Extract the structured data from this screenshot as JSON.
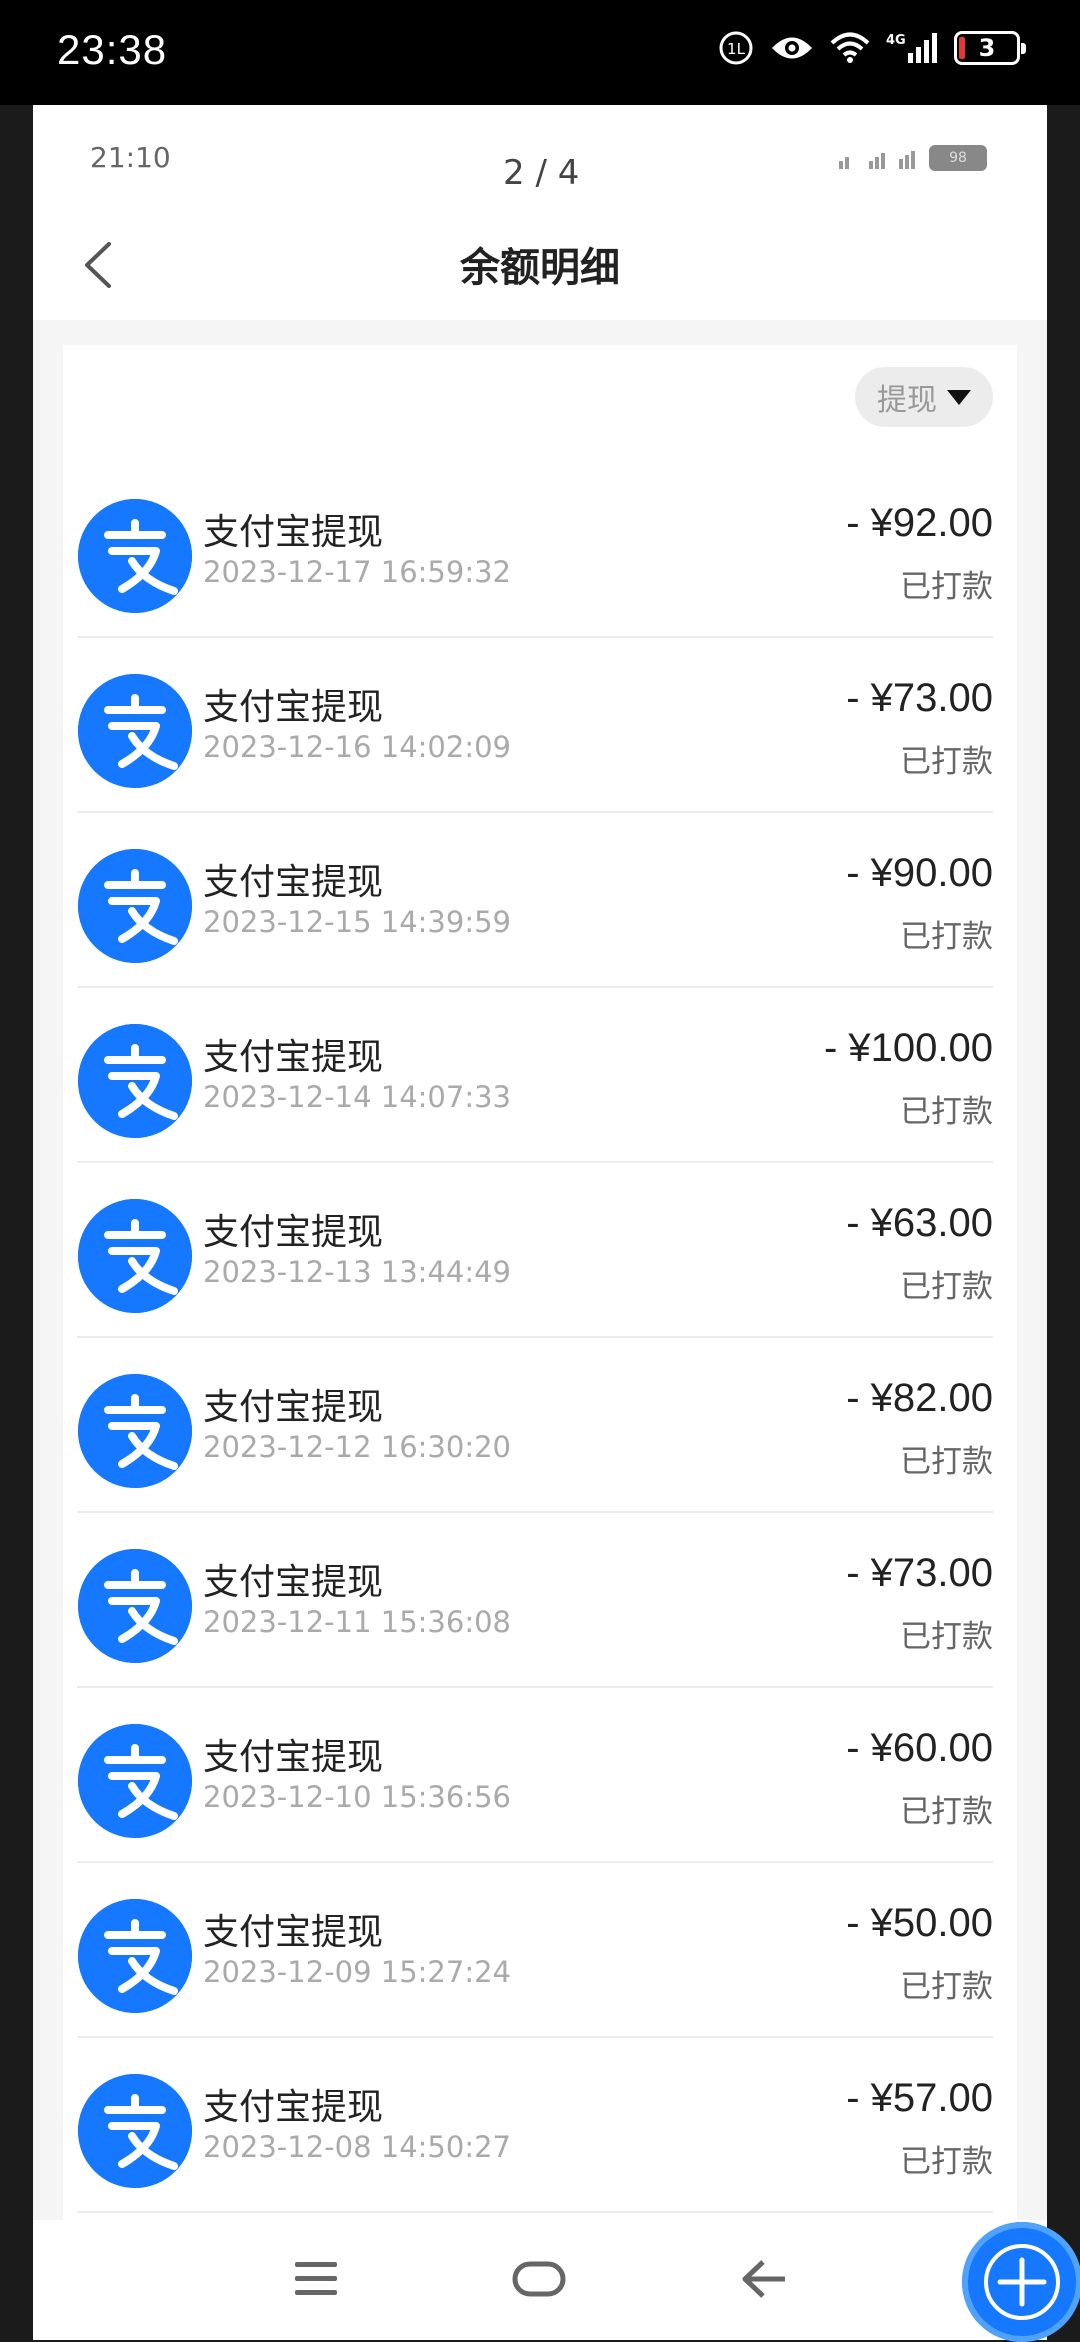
{
  "os_status": {
    "time": "23:38",
    "battery": "3"
  },
  "inner_status": {
    "time": "21:10",
    "page_indicator": "2 / 4",
    "battery": "98"
  },
  "header": {
    "title": "余额明细"
  },
  "filter": {
    "label": "提现"
  },
  "transactions": [
    {
      "title": "支付宝提现",
      "time": "2023-12-17 16:59:32",
      "amount": "- ¥92.00",
      "status": "已打款"
    },
    {
      "title": "支付宝提现",
      "time": "2023-12-16 14:02:09",
      "amount": "- ¥73.00",
      "status": "已打款"
    },
    {
      "title": "支付宝提现",
      "time": "2023-12-15 14:39:59",
      "amount": "- ¥90.00",
      "status": "已打款"
    },
    {
      "title": "支付宝提现",
      "time": "2023-12-14 14:07:33",
      "amount": "- ¥100.00",
      "status": "已打款"
    },
    {
      "title": "支付宝提现",
      "time": "2023-12-13 13:44:49",
      "amount": "- ¥63.00",
      "status": "已打款"
    },
    {
      "title": "支付宝提现",
      "time": "2023-12-12 16:30:20",
      "amount": "- ¥82.00",
      "status": "已打款"
    },
    {
      "title": "支付宝提现",
      "time": "2023-12-11 15:36:08",
      "amount": "- ¥73.00",
      "status": "已打款"
    },
    {
      "title": "支付宝提现",
      "time": "2023-12-10 15:36:56",
      "amount": "- ¥60.00",
      "status": "已打款"
    },
    {
      "title": "支付宝提现",
      "time": "2023-12-09 15:27:24",
      "amount": "- ¥50.00",
      "status": "已打款"
    },
    {
      "title": "支付宝提现",
      "time": "2023-12-08 14:50:27",
      "amount": "- ¥57.00",
      "status": "已打款"
    }
  ],
  "icons": {
    "transaction": "alipay-icon",
    "back": "chevron-left-icon",
    "filter": "caret-down-icon",
    "menu": "menu-icon",
    "home": "home-icon",
    "nav_back": "arrow-left-icon",
    "fab": "plus-icon"
  },
  "colors": {
    "alipay_blue": "#1677ff"
  }
}
